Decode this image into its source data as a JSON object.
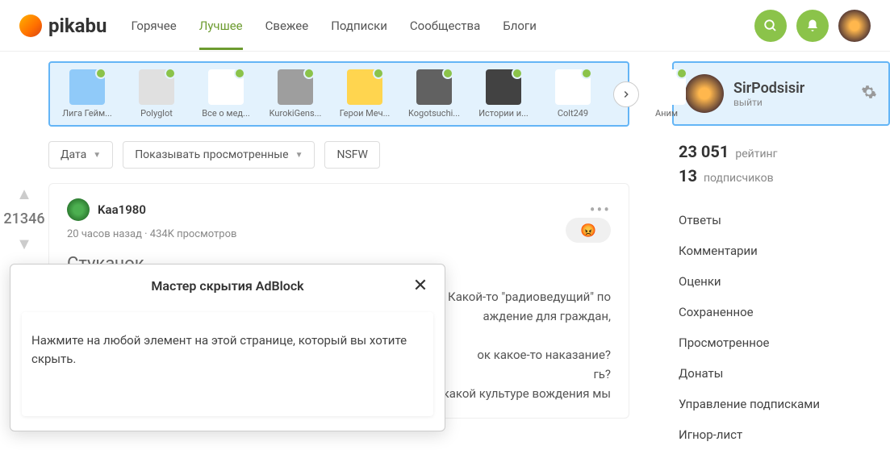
{
  "header": {
    "logo": "pikabu",
    "nav": [
      "Горячее",
      "Лучшее",
      "Свежее",
      "Подписки",
      "Сообщества",
      "Блоги"
    ],
    "active_nav": 1
  },
  "stories": [
    {
      "label": "Лига Гейм..."
    },
    {
      "label": "Polyglot"
    },
    {
      "label": "Все о мед..."
    },
    {
      "label": "KurokiGens..."
    },
    {
      "label": "Герои Меч..."
    },
    {
      "label": "Kogotsuchi..."
    },
    {
      "label": "Истории и..."
    },
    {
      "label": "Colt249"
    },
    {
      "label": "Аним"
    }
  ],
  "filters": {
    "date": "Дата",
    "viewed": "Показывать просмотренные",
    "nsfw": "NSFW"
  },
  "vote": {
    "count": "21346"
  },
  "post": {
    "author": "Kaa1980",
    "meta": "20 часов назад · 434K просмотров",
    "reaction": "😡",
    "title": "Стукачок",
    "body_frag1": "ги. Какой-то \"радиоведущий\" по",
    "body_frag2": "аждение для граждан,",
    "body_frag3": "ок какое-то наказание?",
    "body_frag4": "гь?",
    "body_frag5": "о какой культуре вождения мы"
  },
  "sidebar": {
    "user": {
      "name": "SirPodsisir",
      "logout": "выйти"
    },
    "stats": {
      "rating_num": "23 051",
      "rating_label": "рейтинг",
      "subs_num": "13",
      "subs_label": "подписчиков"
    },
    "menu": [
      "Ответы",
      "Комментарии",
      "Оценки",
      "Сохраненное",
      "Просмотренное",
      "Донаты",
      "Управление подписками",
      "Игнор-лист"
    ]
  },
  "modal": {
    "title": "Мастер скрытия AdBlock",
    "body": "Нажмите на любой элемент на этой странице, который вы хотите скрыть."
  }
}
